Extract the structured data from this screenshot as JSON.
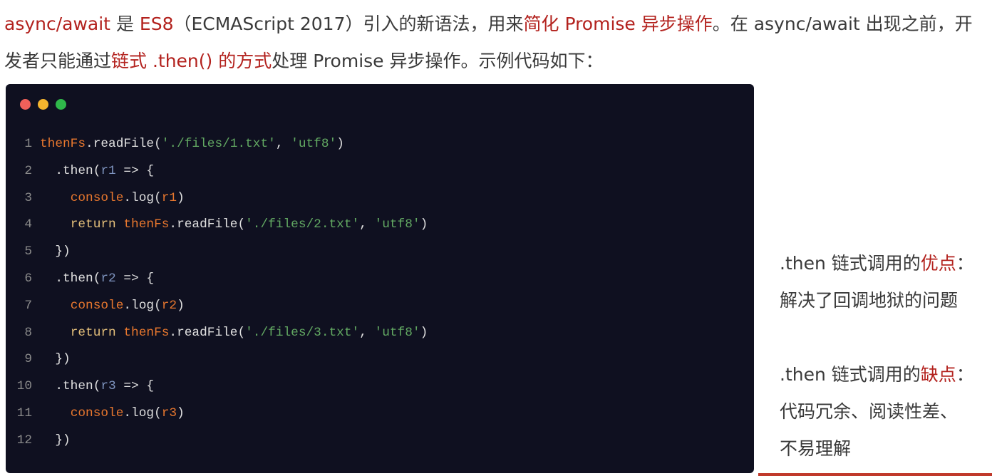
{
  "intro": [
    {
      "t": "async/await",
      "red": true
    },
    {
      "t": " 是 "
    },
    {
      "t": "ES8",
      "red": true
    },
    {
      "t": "（ECMAScript 2017）引入的新语法，用来"
    },
    {
      "t": "简化 Promise 异步操作",
      "red": true
    },
    {
      "t": "。在 async/await 出现之前，开发者只能通过"
    },
    {
      "t": "链式 .then() 的方式",
      "red": true
    },
    {
      "t": "处理 Promise 异步操作。示例代码如下："
    }
  ],
  "window_dots": {
    "close": "#f0605a",
    "minimize": "#f5b52e",
    "maximize": "#2fb84a"
  },
  "code": [
    [
      [
        "fn",
        "thenFs"
      ],
      [
        "p",
        ".readFile("
      ],
      [
        "str",
        "'./files/1.txt'"
      ],
      [
        "p",
        ", "
      ],
      [
        "str",
        "'utf8'"
      ],
      [
        "p",
        ")"
      ]
    ],
    [
      [
        "p",
        "  .then("
      ],
      [
        "var",
        "r1"
      ],
      [
        "p",
        " => {"
      ]
    ],
    [
      [
        "p",
        "    "
      ],
      [
        "fn",
        "console"
      ],
      [
        "p",
        ".log("
      ],
      [
        "fn",
        "r1"
      ],
      [
        "p",
        ")"
      ]
    ],
    [
      [
        "p",
        "    "
      ],
      [
        "kw",
        "return "
      ],
      [
        "fn",
        "thenFs"
      ],
      [
        "p",
        ".readFile("
      ],
      [
        "str",
        "'./files/2.txt'"
      ],
      [
        "p",
        ", "
      ],
      [
        "str",
        "'utf8'"
      ],
      [
        "p",
        ")"
      ]
    ],
    [
      [
        "p",
        "  })"
      ]
    ],
    [
      [
        "p",
        "  .then("
      ],
      [
        "var",
        "r2"
      ],
      [
        "p",
        " => {"
      ]
    ],
    [
      [
        "p",
        "    "
      ],
      [
        "fn",
        "console"
      ],
      [
        "p",
        ".log("
      ],
      [
        "fn",
        "r2"
      ],
      [
        "p",
        ")"
      ]
    ],
    [
      [
        "p",
        "    "
      ],
      [
        "kw",
        "return "
      ],
      [
        "fn",
        "thenFs"
      ],
      [
        "p",
        ".readFile("
      ],
      [
        "str",
        "'./files/3.txt'"
      ],
      [
        "p",
        ", "
      ],
      [
        "str",
        "'utf8'"
      ],
      [
        "p",
        ")"
      ]
    ],
    [
      [
        "p",
        "  })"
      ]
    ],
    [
      [
        "p",
        "  .then("
      ],
      [
        "var",
        "r3"
      ],
      [
        "p",
        " => {"
      ]
    ],
    [
      [
        "p",
        "    "
      ],
      [
        "fn",
        "console"
      ],
      [
        "p",
        ".log("
      ],
      [
        "fn",
        "r3"
      ],
      [
        "p",
        ")"
      ]
    ],
    [
      [
        "p",
        "  })"
      ]
    ]
  ],
  "pros": {
    "prefix": ".then 链式调用的",
    "highlight": "优点",
    "suffix": "：",
    "text": "解决了回调地狱的问题"
  },
  "cons": {
    "prefix": ".then 链式调用的",
    "highlight": "缺点",
    "suffix": "：",
    "line1": "代码冗余、阅读性差、",
    "line2": "不易理解"
  }
}
